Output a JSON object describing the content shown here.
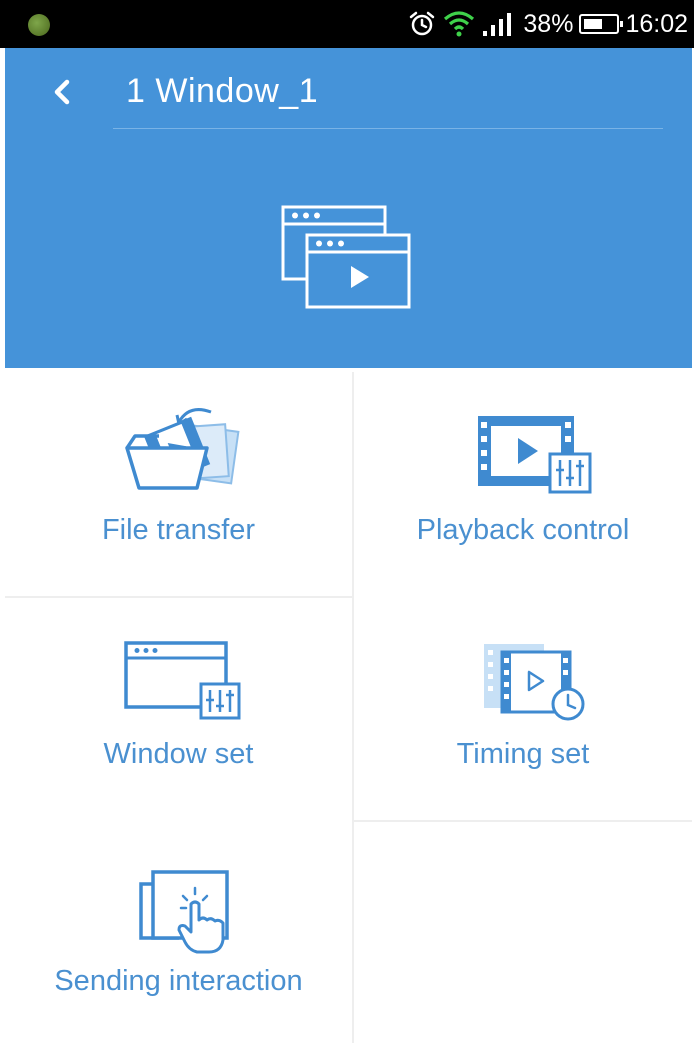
{
  "status_bar": {
    "battery_percent": "38%",
    "battery_level": 0.38,
    "time": "16:02",
    "icons": [
      "app-icon",
      "alarm-icon",
      "wifi-icon",
      "signal-icon",
      "battery-icon"
    ]
  },
  "header": {
    "title": "1 Window_1",
    "back_icon": "chevron-left-icon",
    "hero_icon": "windows-play-icon"
  },
  "menu": {
    "items": [
      {
        "label": "File transfer",
        "icon": "folder-transfer-icon"
      },
      {
        "label": "Playback control",
        "icon": "video-sliders-icon"
      },
      {
        "label": "Window set",
        "icon": "window-sliders-icon"
      },
      {
        "label": "Timing set",
        "icon": "video-clock-icon"
      },
      {
        "label": "Sending interaction",
        "icon": "touch-interaction-icon"
      }
    ]
  },
  "colors": {
    "primary": "#4593d9",
    "accent_text": "#4a90d0",
    "icon_blue": "#3f8ad0",
    "divider": "#eeeeee"
  }
}
